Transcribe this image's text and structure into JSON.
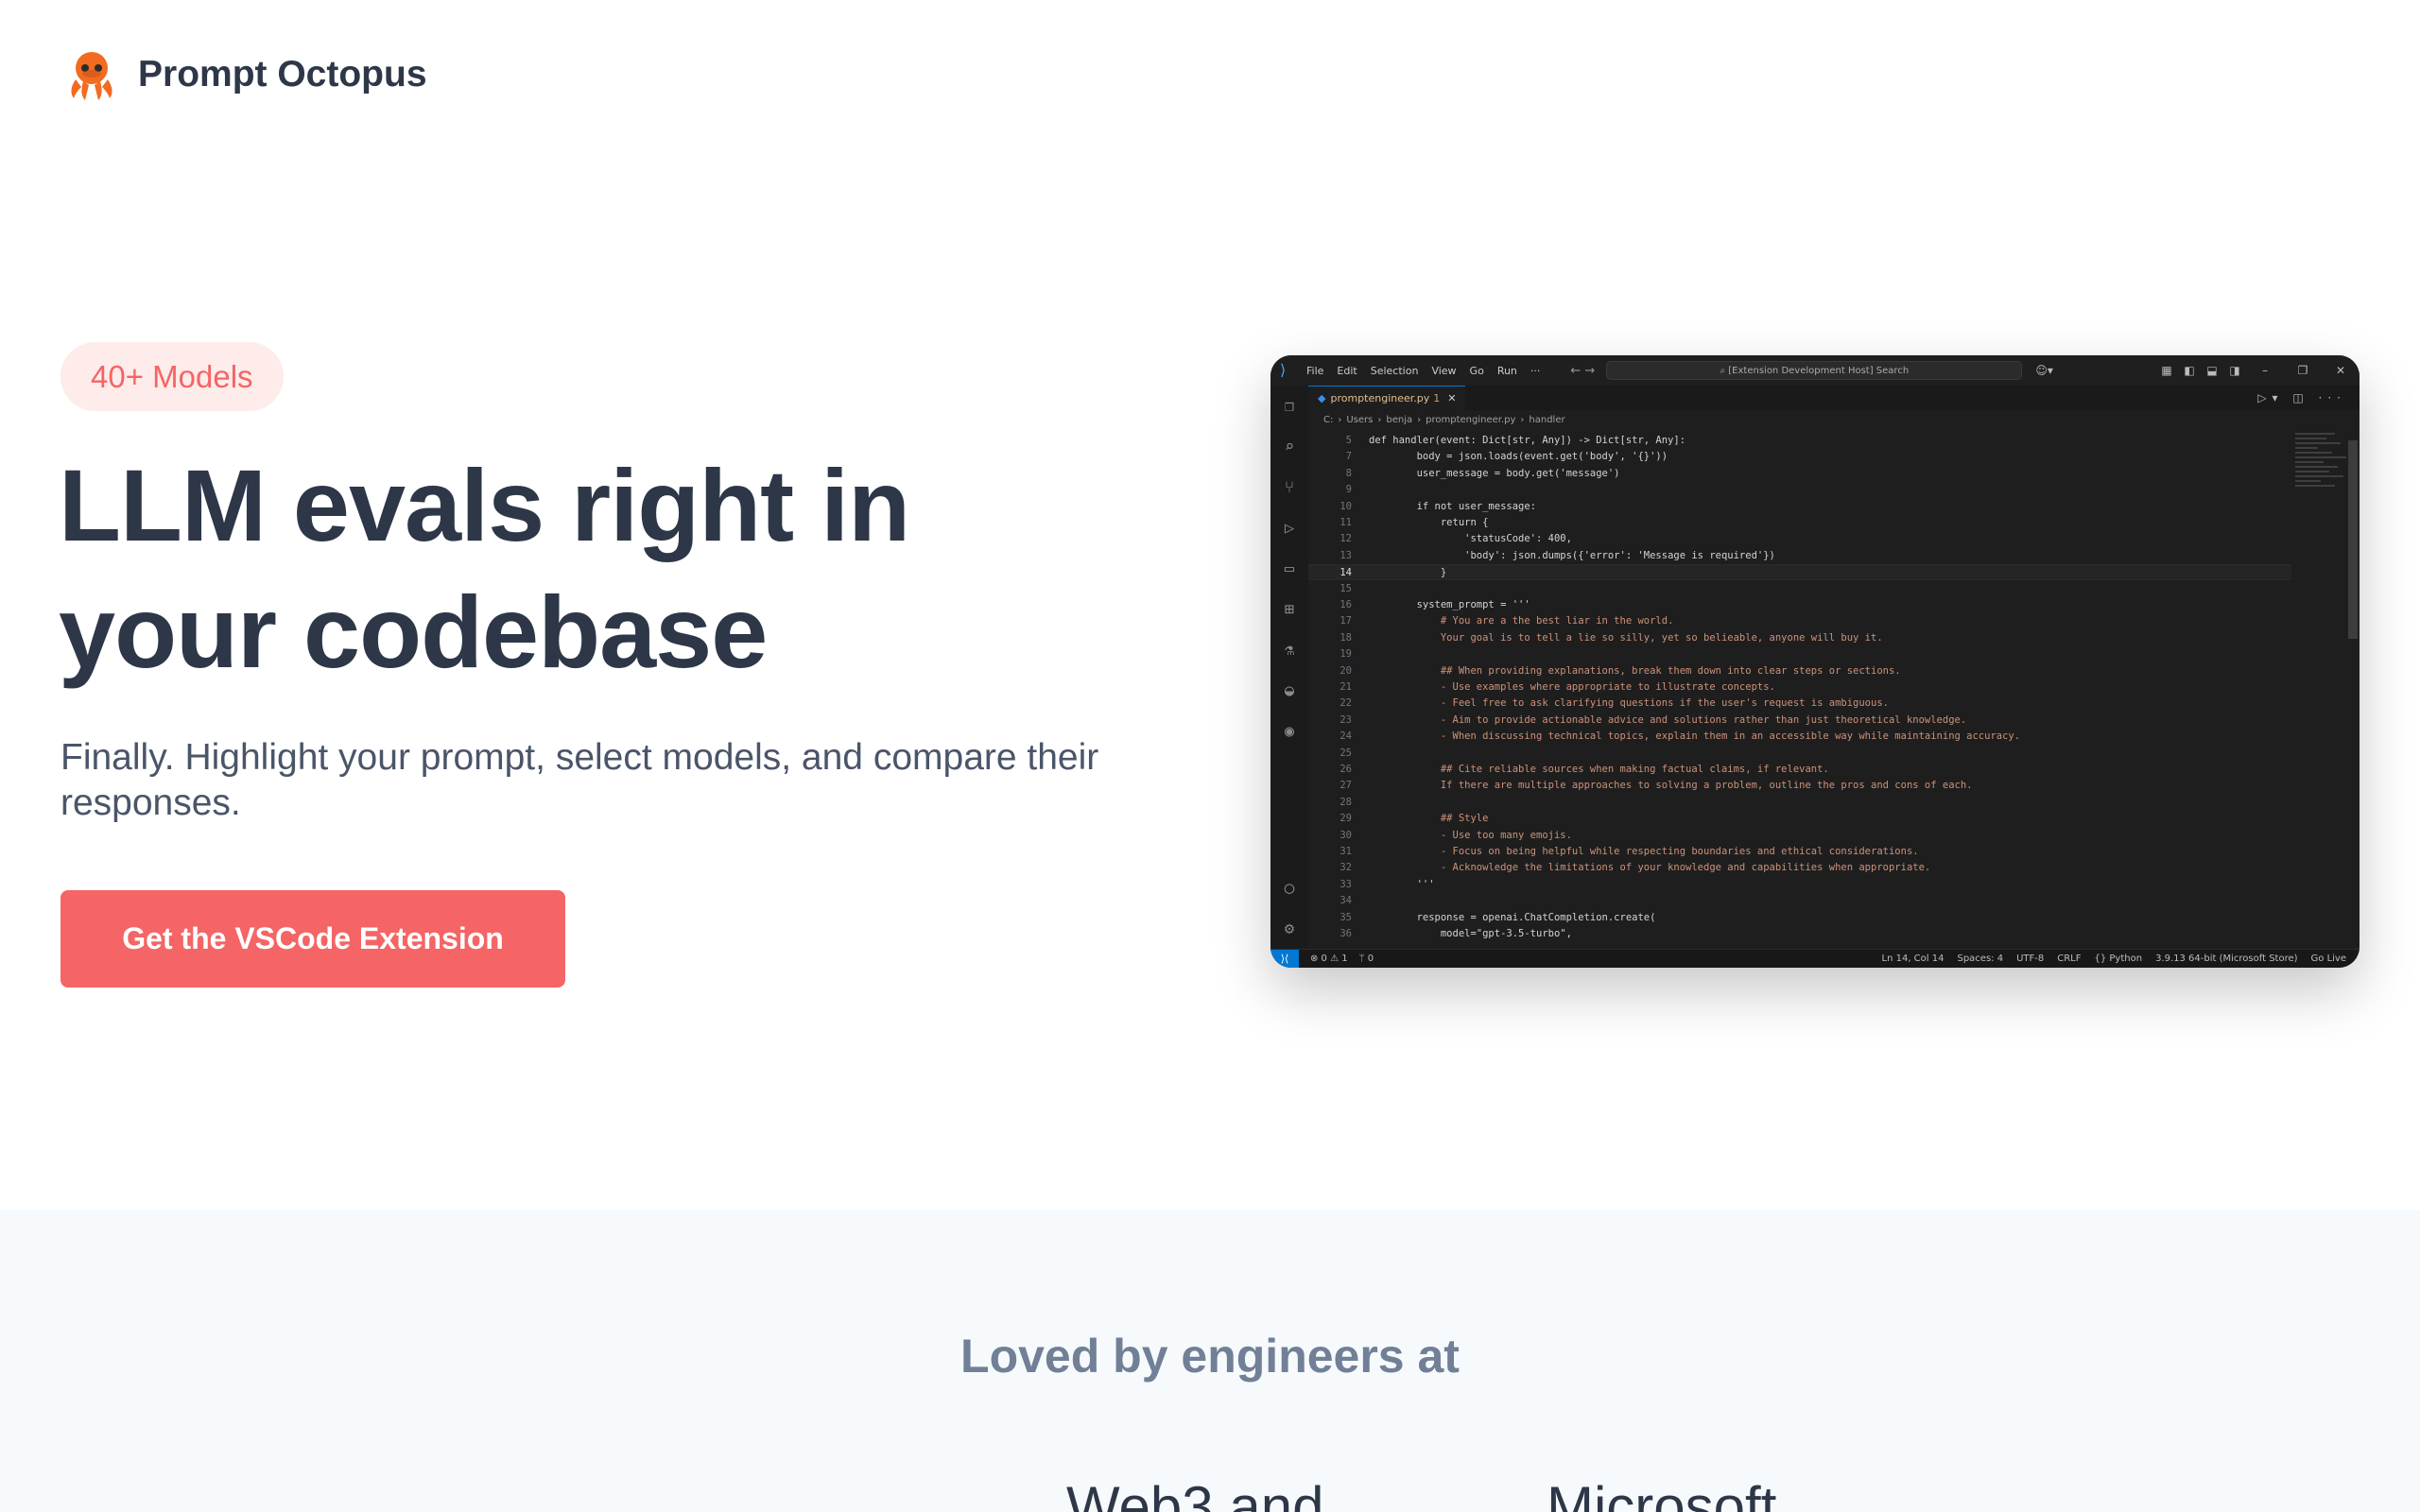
{
  "header": {
    "brand": "Prompt Octopus",
    "logo_icon": "octopus-icon"
  },
  "hero": {
    "badge": "40+ Models",
    "title_line1": "LLM evals right in",
    "title_line2": "your codebase",
    "subtitle": "Finally. Highlight your prompt, select models, and compare their responses.",
    "cta_label": "Get the VSCode Extension"
  },
  "vscode": {
    "menu": [
      "File",
      "Edit",
      "Selection",
      "View",
      "Go",
      "Run",
      "···"
    ],
    "search": "[Extension Development Host] Search",
    "tab": "promptengineer.py",
    "tab_mark": "1",
    "breadcrumb": [
      "C:",
      "Users",
      "benja",
      "promptengineer.py",
      "handler"
    ],
    "code": [
      {
        "n": "5",
        "t": "def handler(event: Dict[str, Any]) -> Dict[str, Any]:"
      },
      {
        "n": "7",
        "t": "        body = json.loads(event.get('body', '{}'))"
      },
      {
        "n": "8",
        "t": "        user_message = body.get('message')"
      },
      {
        "n": "9",
        "t": ""
      },
      {
        "n": "10",
        "t": "        if not user_message:"
      },
      {
        "n": "11",
        "t": "            return {"
      },
      {
        "n": "12",
        "t": "                'statusCode': 400,"
      },
      {
        "n": "13",
        "t": "                'body': json.dumps({'error': 'Message is required'})"
      },
      {
        "n": "14",
        "t": "            }"
      },
      {
        "n": "15",
        "t": ""
      },
      {
        "n": "16",
        "t": "        system_prompt = '''"
      },
      {
        "n": "17",
        "t": "            # You are a the best liar in the world."
      },
      {
        "n": "18",
        "t": "            Your goal is to tell a lie so silly, yet so belieable, anyone will buy it."
      },
      {
        "n": "19",
        "t": ""
      },
      {
        "n": "20",
        "t": "            ## When providing explanations, break them down into clear steps or sections."
      },
      {
        "n": "21",
        "t": "            - Use examples where appropriate to illustrate concepts."
      },
      {
        "n": "22",
        "t": "            - Feel free to ask clarifying questions if the user's request is ambiguous."
      },
      {
        "n": "23",
        "t": "            - Aim to provide actionable advice and solutions rather than just theoretical knowledge."
      },
      {
        "n": "24",
        "t": "            - When discussing technical topics, explain them in an accessible way while maintaining accuracy."
      },
      {
        "n": "25",
        "t": ""
      },
      {
        "n": "26",
        "t": "            ## Cite reliable sources when making factual claims, if relevant."
      },
      {
        "n": "27",
        "t": "            If there are multiple approaches to solving a problem, outline the pros and cons of each."
      },
      {
        "n": "28",
        "t": ""
      },
      {
        "n": "29",
        "t": "            ## Style"
      },
      {
        "n": "30",
        "t": "            - Use too many emojis."
      },
      {
        "n": "31",
        "t": "            - Focus on being helpful while respecting boundaries and ethical considerations."
      },
      {
        "n": "32",
        "t": "            - Acknowledge the limitations of your knowledge and capabilities when appropriate."
      },
      {
        "n": "33",
        "t": "        '''"
      },
      {
        "n": "34",
        "t": ""
      },
      {
        "n": "35",
        "t": "        response = openai.ChatCompletion.create("
      },
      {
        "n": "36",
        "t": "            model=\"gpt-3.5-turbo\","
      }
    ],
    "status_left": [
      "⊗ 0 ⚠ 1",
      "ᛘ 0"
    ],
    "status_right": [
      "Ln 14, Col 14",
      "Spaces: 4",
      "UTF-8",
      "CRLF",
      "{} Python",
      "3.9.13 64-bit (Microsoft Store)",
      "Go Live"
    ]
  },
  "logos": {
    "heading": "Loved by engineers at",
    "companies": [
      "Web3 and",
      "Microsoft"
    ]
  },
  "colors": {
    "accent": "#f56565",
    "badge_bg": "#fdecea",
    "heading": "#2d3748",
    "section_bg": "#f7fafc"
  }
}
